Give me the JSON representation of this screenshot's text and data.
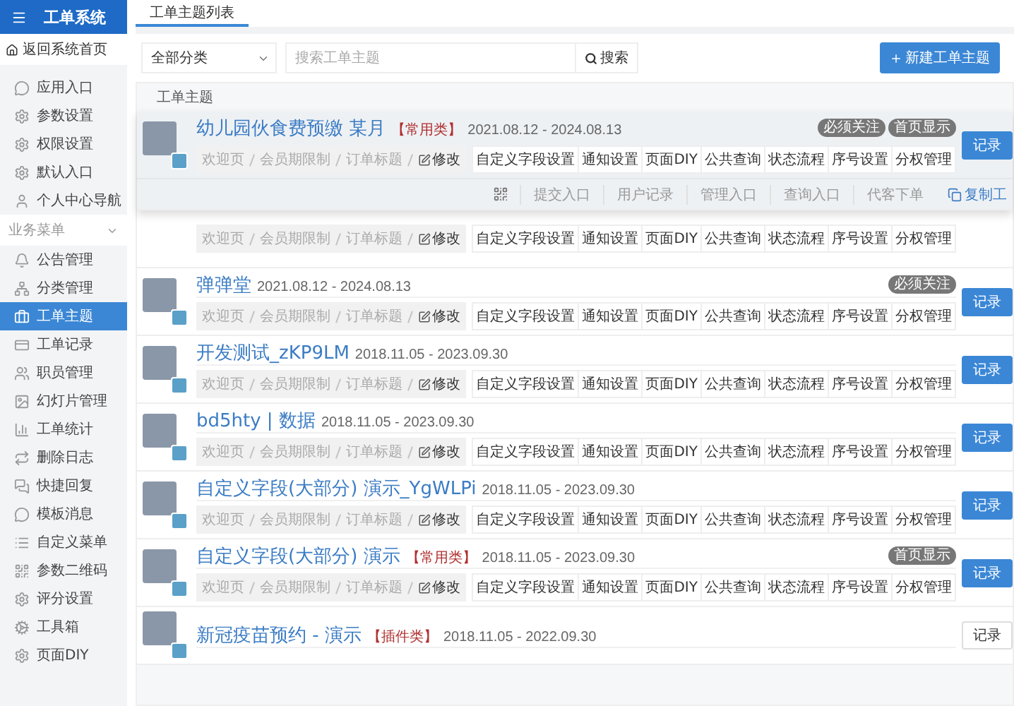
{
  "sidebar": {
    "title": "工单系统",
    "back_link": "返回系统首页",
    "items": [
      {
        "label": "应用入口",
        "selected": false
      },
      {
        "label": "参数设置",
        "selected": false
      },
      {
        "label": "权限设置",
        "selected": false
      },
      {
        "label": "默认入口",
        "selected": false
      },
      {
        "label": "个人中心导航",
        "selected": false
      }
    ],
    "sections": [
      {
        "title": "业务菜单",
        "expanded": true,
        "items": [
          {
            "label": "公告管理",
            "selected": false
          },
          {
            "label": "分类管理",
            "selected": false
          },
          {
            "label": "工单主题",
            "selected": true
          },
          {
            "label": "工单记录",
            "selected": false
          },
          {
            "label": "职员管理",
            "selected": false
          },
          {
            "label": "幻灯片管理",
            "selected": false
          },
          {
            "label": "工单统计",
            "selected": false
          },
          {
            "label": "删除日志",
            "selected": false
          },
          {
            "label": "快捷回复",
            "selected": false
          },
          {
            "label": "模板消息",
            "selected": false
          },
          {
            "label": "自定义菜单",
            "selected": false
          },
          {
            "label": "参数二维码",
            "selected": false
          },
          {
            "label": "评分设置",
            "selected": false
          },
          {
            "label": "工具箱",
            "selected": false
          },
          {
            "label": "页面DIY",
            "selected": false
          }
        ]
      }
    ]
  },
  "tabs": [
    {
      "label": "工单主题列表",
      "selected": true
    }
  ],
  "toolbar": {
    "category": "全部分类",
    "search_placeholder": "搜索工单主题",
    "search_button": "搜索",
    "new_button": "新建工单主题"
  },
  "table": {
    "column": "工单主题",
    "rows": [
      {
        "kind": "full",
        "expanded": true,
        "title": "幼儿园伙食费预缴 某月",
        "tag": "【常用类】",
        "dates": "2021.08.12 - 2024.08.13",
        "badges": [
          "必须关注",
          "首页显示"
        ],
        "breadcrumb": [
          "欢迎页",
          "会员期限制",
          "订单标题"
        ],
        "edit": "修改",
        "buttons": [
          "自定义字段设置",
          "通知设置",
          "页面DIY",
          "公共查询",
          "状态流程",
          "序号设置",
          "分权管理"
        ],
        "record": "记录",
        "record_outline": false,
        "entries": [
          "提交入口",
          "用户记录",
          "管理入口",
          "查询入口",
          "代客下单"
        ],
        "copy": "复制工"
      },
      {
        "kind": "actions_only",
        "expanded": false,
        "breadcrumb": [
          "欢迎页",
          "会员期限制",
          "订单标题"
        ],
        "edit": "修改",
        "buttons": [
          "自定义字段设置",
          "通知设置",
          "页面DIY",
          "公共查询",
          "状态流程",
          "序号设置",
          "分权管理"
        ]
      },
      {
        "kind": "full",
        "expanded": false,
        "title": "弹弹堂",
        "dates": "2021.08.12 - 2024.08.13",
        "badges": [
          "必须关注"
        ],
        "breadcrumb": [
          "欢迎页",
          "会员期限制",
          "订单标题"
        ],
        "edit": "修改",
        "buttons": [
          "自定义字段设置",
          "通知设置",
          "页面DIY",
          "公共查询",
          "状态流程",
          "序号设置",
          "分权管理"
        ],
        "record": "记录",
        "record_outline": false
      },
      {
        "kind": "full",
        "expanded": false,
        "title": "开发测试_zKP9LM",
        "dates": "2018.11.05 - 2023.09.30",
        "breadcrumb": [
          "欢迎页",
          "会员期限制",
          "订单标题"
        ],
        "edit": "修改",
        "buttons": [
          "自定义字段设置",
          "通知设置",
          "页面DIY",
          "公共查询",
          "状态流程",
          "序号设置",
          "分权管理"
        ],
        "record": "记录",
        "record_outline": false
      },
      {
        "kind": "full",
        "expanded": false,
        "title": "bd5hty | 数据",
        "dates": "2018.11.05 - 2023.09.30",
        "breadcrumb": [
          "欢迎页",
          "会员期限制",
          "订单标题"
        ],
        "edit": "修改",
        "buttons": [
          "自定义字段设置",
          "通知设置",
          "页面DIY",
          "公共查询",
          "状态流程",
          "序号设置",
          "分权管理"
        ],
        "record": "记录",
        "record_outline": false
      },
      {
        "kind": "full",
        "expanded": false,
        "title": "自定义字段(大部分) 演示_YgWLPi",
        "dates": "2018.11.05 - 2023.09.30",
        "breadcrumb": [
          "欢迎页",
          "会员期限制",
          "订单标题"
        ],
        "edit": "修改",
        "buttons": [
          "自定义字段设置",
          "通知设置",
          "页面DIY",
          "公共查询",
          "状态流程",
          "序号设置",
          "分权管理"
        ],
        "record": "记录",
        "record_outline": false
      },
      {
        "kind": "full",
        "expanded": false,
        "title": "自定义字段(大部分) 演示",
        "tag": "【常用类】",
        "dates": "2018.11.05 - 2023.09.30",
        "badges": [
          "首页显示"
        ],
        "breadcrumb": [
          "欢迎页",
          "会员期限制",
          "订单标题"
        ],
        "edit": "修改",
        "buttons": [
          "自定义字段设置",
          "通知设置",
          "页面DIY",
          "公共查询",
          "状态流程",
          "序号设置",
          "分权管理"
        ],
        "record": "记录",
        "record_outline": false
      },
      {
        "kind": "title_only",
        "expanded": false,
        "title": "新冠疫苗预约 - 演示",
        "tag": "【插件类】",
        "dates": "2018.11.05 - 2022.09.30",
        "record": "记录",
        "record_outline": true
      }
    ]
  }
}
